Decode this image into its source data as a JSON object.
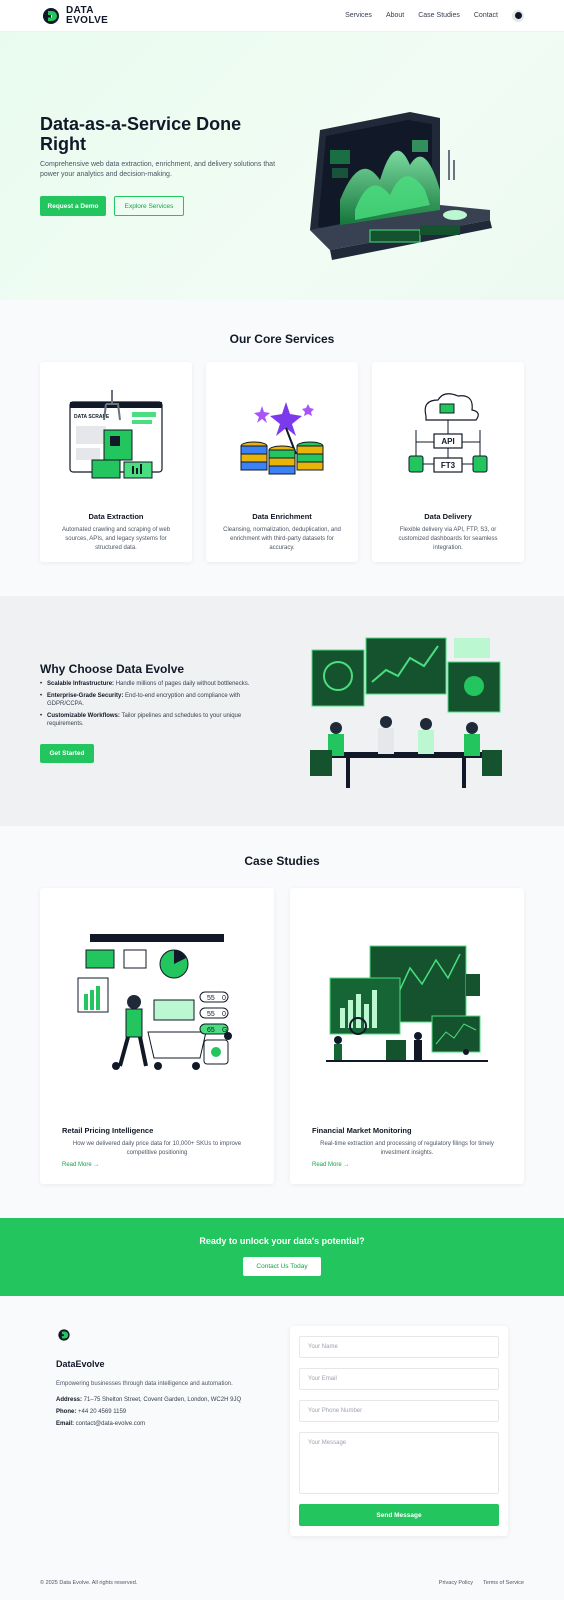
{
  "nav": {
    "logo_line1": "DATA",
    "logo_line2": "EVOLVE",
    "links": [
      "Services",
      "About",
      "Case Studies",
      "Contact"
    ],
    "theme_toggle_icon": "moon-icon"
  },
  "hero": {
    "title": "Data-as-a-Service Done Right",
    "subtitle": "Comprehensive web data extraction, enrichment, and delivery solutions that power your analytics and decision-making.",
    "primary_cta": "Request a Demo",
    "secondary_cta": "Explore Services"
  },
  "services": {
    "title": "Our Core Services",
    "items": [
      {
        "title": "Data Extraction",
        "desc": "Automated crawling and scraping of web sources, APIs, and legacy systems for structured data.",
        "illus_label": "DATA SCRAPE"
      },
      {
        "title": "Data Enrichment",
        "desc": "Cleansing, normalization, deduplication, and enrichment with third-party datasets for accuracy."
      },
      {
        "title": "Data Delivery",
        "desc": "Flexible delivery via API, FTP, S3, or customized dashboards for seamless integration.",
        "api_label": "API",
        "ft3_label": "FT3"
      }
    ]
  },
  "why": {
    "title": "Why Choose Data Evolve",
    "points": [
      {
        "bold": "Scalable Infrastructure:",
        "text": " Handle millions of pages daily without bottlenecks."
      },
      {
        "bold": "Enterprise-Grade Security:",
        "text": " End-to-end encryption and compliance with GDPR/CCPA."
      },
      {
        "bold": "Customizable Workflows:",
        "text": " Tailor pipelines and schedules to your unique requirements."
      }
    ],
    "cta": "Get Started"
  },
  "cases": {
    "title": "Case Studies",
    "items": [
      {
        "title": "Retail Pricing Intelligence",
        "desc": "How we delivered daily price data for 10,000+ SKUs to improve competitive positioning",
        "link": "Read More →",
        "tags": [
          "55",
          "0",
          "55",
          "0",
          "65",
          "G"
        ]
      },
      {
        "title": "Financial Market Monitoring",
        "desc": "Real-time extraction and processing of regulatory filings for timely investment insights.",
        "link": "Read More →"
      }
    ]
  },
  "cta": {
    "title": "Ready to unlock your data's potential?",
    "button": "Contact Us Today"
  },
  "footer": {
    "brand": "DataEvolve",
    "tagline": "Empowering businesses through data intelligence and automation.",
    "address_label": "Address:",
    "address": " 71–75 Shelton Street, Covent Garden, London, WC2H 9JQ",
    "phone_label": "Phone:",
    "phone": " +44 20 4569 1159",
    "email_label": "Email:",
    "email": " contact@data-evolve.com",
    "form": {
      "name_placeholder": "Your Name",
      "email_placeholder": "Your Email",
      "phone_placeholder": "Your Phone Number",
      "message_placeholder": "Your Message",
      "submit": "Send Message"
    },
    "copyright": "© 2025 Data Evolve. All rights reserved.",
    "privacy": "Privacy Policy",
    "terms": "Terms of Service"
  },
  "colors": {
    "accent": "#22c55e",
    "accent_dark": "#16a34a",
    "dark": "#111827"
  }
}
